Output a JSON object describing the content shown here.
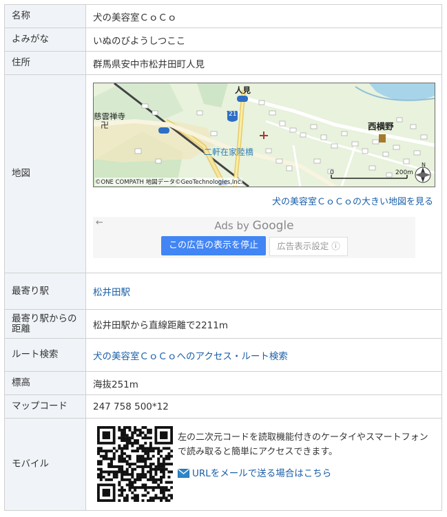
{
  "labels": {
    "name": "名称",
    "kana": "よみがな",
    "address": "住所",
    "map": "地図",
    "nearest_station": "最寄り駅",
    "station_distance": "最寄り駅からの距離",
    "route": "ルート検索",
    "elevation": "標高",
    "mapcode": "マップコード",
    "mobile": "モバイル"
  },
  "values": {
    "name": "犬の美容室ＣｏＣｏ",
    "kana": "いぬのびようしつここ",
    "address": "群馬県安中市松井田町人見",
    "nearest_station": "松井田駅",
    "station_distance": "松井田駅から直線距離で2211m",
    "route": "犬の美容室ＣｏＣｏへのアクセス・ルート検索",
    "elevation": "海抜251m",
    "mapcode": "247 758 500*12"
  },
  "map": {
    "labels": {
      "hitomi": "人見",
      "route217": "217",
      "route212": "212",
      "temple": "慈雲禅寺",
      "nishiyokono": "西横野",
      "nikenzaike": "二軒在家陸橋",
      "scale": "200m",
      "scale_zero": "0",
      "north": "N",
      "credit": "©ONE COMPATH 地図データ©GeoTechnologies,Inc."
    },
    "big_map_link": "犬の美容室ＣｏＣｏの大きい地図を見る"
  },
  "ads": {
    "back": "←",
    "ads_by": "Ads by ",
    "google": "Google",
    "stop": "この広告の表示を停止",
    "setting": "広告表示設定 ⓘ"
  },
  "mobile": {
    "description": "左の二次元コードを読取機能付きのケータイやスマートフォンで読み取ると簡単にアクセスできます。",
    "mail_link": "URLをメールで送る場合はこちら"
  },
  "colors": {
    "label_bg": "#f0f4f8",
    "link": "#1a5fa8",
    "border": "#cfcfcf",
    "ads_button": "#4285f4"
  }
}
